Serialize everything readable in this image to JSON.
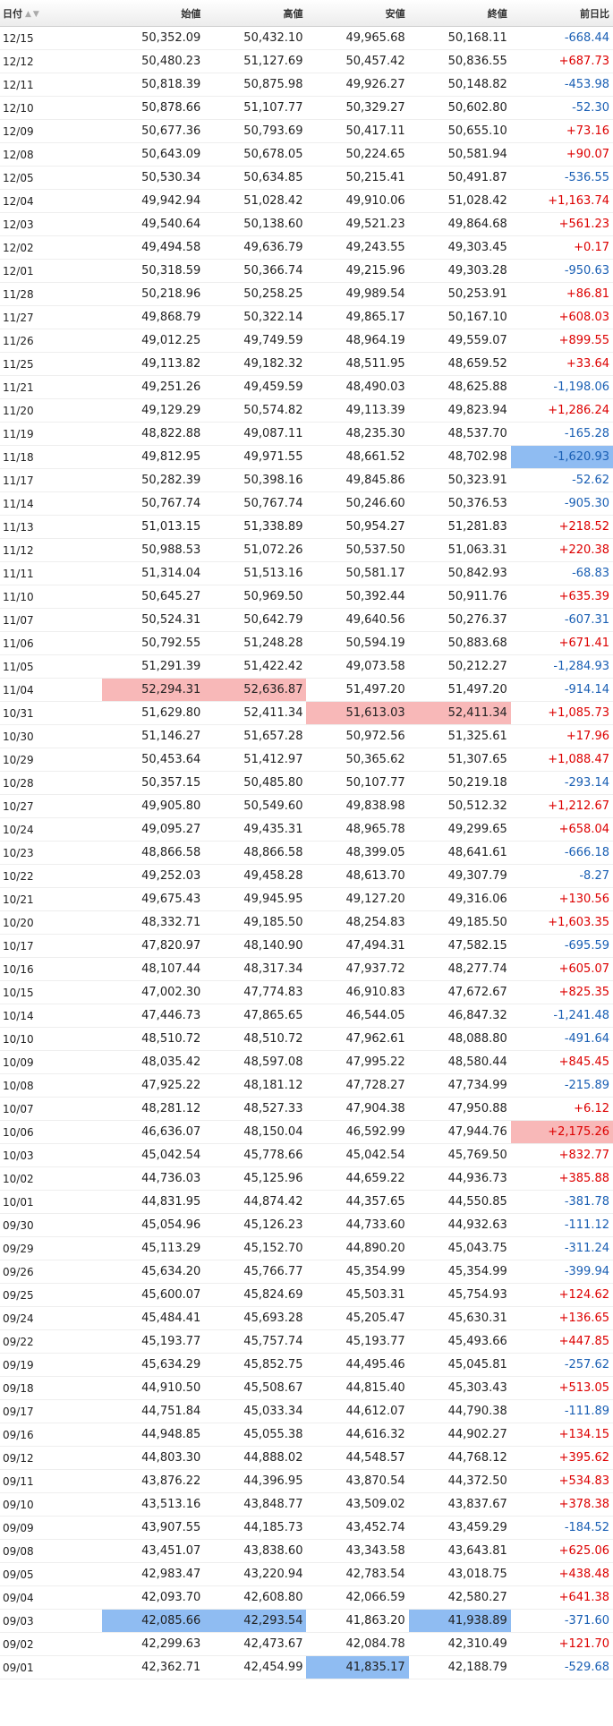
{
  "table": {
    "headers": [
      "日付",
      "始値",
      "高値",
      "安値",
      "終値",
      "前日比"
    ],
    "sort_indicator": "▲▼",
    "rows": [
      {
        "date": "12/15",
        "open": "50,352.09",
        "high": "50,432.10",
        "low": "49,965.68",
        "close": "50,168.11",
        "change": "-668.44"
      },
      {
        "date": "12/12",
        "open": "50,480.23",
        "high": "51,127.69",
        "low": "50,457.42",
        "close": "50,836.55",
        "change": "+687.73"
      },
      {
        "date": "12/11",
        "open": "50,818.39",
        "high": "50,875.98",
        "low": "49,926.27",
        "close": "50,148.82",
        "change": "-453.98"
      },
      {
        "date": "12/10",
        "open": "50,878.66",
        "high": "51,107.77",
        "low": "50,329.27",
        "close": "50,602.80",
        "change": "-52.30"
      },
      {
        "date": "12/09",
        "open": "50,677.36",
        "high": "50,793.69",
        "low": "50,417.11",
        "close": "50,655.10",
        "change": "+73.16"
      },
      {
        "date": "12/08",
        "open": "50,643.09",
        "high": "50,678.05",
        "low": "50,224.65",
        "close": "50,581.94",
        "change": "+90.07"
      },
      {
        "date": "12/05",
        "open": "50,530.34",
        "high": "50,634.85",
        "low": "50,215.41",
        "close": "50,491.87",
        "change": "-536.55"
      },
      {
        "date": "12/04",
        "open": "49,942.94",
        "high": "51,028.42",
        "low": "49,910.06",
        "close": "51,028.42",
        "change": "+1,163.74"
      },
      {
        "date": "12/03",
        "open": "49,540.64",
        "high": "50,138.60",
        "low": "49,521.23",
        "close": "49,864.68",
        "change": "+561.23"
      },
      {
        "date": "12/02",
        "open": "49,494.58",
        "high": "49,636.79",
        "low": "49,243.55",
        "close": "49,303.45",
        "change": "+0.17"
      },
      {
        "date": "12/01",
        "open": "50,318.59",
        "high": "50,366.74",
        "low": "49,215.96",
        "close": "49,303.28",
        "change": "-950.63"
      },
      {
        "date": "11/28",
        "open": "50,218.96",
        "high": "50,258.25",
        "low": "49,989.54",
        "close": "50,253.91",
        "change": "+86.81"
      },
      {
        "date": "11/27",
        "open": "49,868.79",
        "high": "50,322.14",
        "low": "49,865.17",
        "close": "50,167.10",
        "change": "+608.03"
      },
      {
        "date": "11/26",
        "open": "49,012.25",
        "high": "49,749.59",
        "low": "48,964.19",
        "close": "49,559.07",
        "change": "+899.55"
      },
      {
        "date": "11/25",
        "open": "49,113.82",
        "high": "49,182.32",
        "low": "48,511.95",
        "close": "48,659.52",
        "change": "+33.64"
      },
      {
        "date": "11/21",
        "open": "49,251.26",
        "high": "49,459.59",
        "low": "48,490.03",
        "close": "48,625.88",
        "change": "-1,198.06"
      },
      {
        "date": "11/20",
        "open": "49,129.29",
        "high": "50,574.82",
        "low": "49,113.39",
        "close": "49,823.94",
        "change": "+1,286.24"
      },
      {
        "date": "11/19",
        "open": "48,822.88",
        "high": "49,087.11",
        "low": "48,235.30",
        "close": "48,537.70",
        "change": "-165.28"
      },
      {
        "date": "11/18",
        "open": "49,812.95",
        "high": "49,971.55",
        "low": "48,661.52",
        "close": "48,702.98",
        "change": "-1,620.93",
        "hl": {
          "change": "blue"
        }
      },
      {
        "date": "11/17",
        "open": "50,282.39",
        "high": "50,398.16",
        "low": "49,845.86",
        "close": "50,323.91",
        "change": "-52.62"
      },
      {
        "date": "11/14",
        "open": "50,767.74",
        "high": "50,767.74",
        "low": "50,246.60",
        "close": "50,376.53",
        "change": "-905.30"
      },
      {
        "date": "11/13",
        "open": "51,013.15",
        "high": "51,338.89",
        "low": "50,954.27",
        "close": "51,281.83",
        "change": "+218.52"
      },
      {
        "date": "11/12",
        "open": "50,988.53",
        "high": "51,072.26",
        "low": "50,537.50",
        "close": "51,063.31",
        "change": "+220.38"
      },
      {
        "date": "11/11",
        "open": "51,314.04",
        "high": "51,513.16",
        "low": "50,581.17",
        "close": "50,842.93",
        "change": "-68.83"
      },
      {
        "date": "11/10",
        "open": "50,645.27",
        "high": "50,969.50",
        "low": "50,392.44",
        "close": "50,911.76",
        "change": "+635.39"
      },
      {
        "date": "11/07",
        "open": "50,524.31",
        "high": "50,642.79",
        "low": "49,640.56",
        "close": "50,276.37",
        "change": "-607.31"
      },
      {
        "date": "11/06",
        "open": "50,792.55",
        "high": "51,248.28",
        "low": "50,594.19",
        "close": "50,883.68",
        "change": "+671.41"
      },
      {
        "date": "11/05",
        "open": "51,291.39",
        "high": "51,422.42",
        "low": "49,073.58",
        "close": "50,212.27",
        "change": "-1,284.93"
      },
      {
        "date": "11/04",
        "open": "52,294.31",
        "high": "52,636.87",
        "low": "51,497.20",
        "close": "51,497.20",
        "change": "-914.14",
        "hl": {
          "open": "red",
          "high": "red"
        }
      },
      {
        "date": "10/31",
        "open": "51,629.80",
        "high": "52,411.34",
        "low": "51,613.03",
        "close": "52,411.34",
        "change": "+1,085.73",
        "hl": {
          "low": "red",
          "close": "red"
        }
      },
      {
        "date": "10/30",
        "open": "51,146.27",
        "high": "51,657.28",
        "low": "50,972.56",
        "close": "51,325.61",
        "change": "+17.96"
      },
      {
        "date": "10/29",
        "open": "50,453.64",
        "high": "51,412.97",
        "low": "50,365.62",
        "close": "51,307.65",
        "change": "+1,088.47"
      },
      {
        "date": "10/28",
        "open": "50,357.15",
        "high": "50,485.80",
        "low": "50,107.77",
        "close": "50,219.18",
        "change": "-293.14"
      },
      {
        "date": "10/27",
        "open": "49,905.80",
        "high": "50,549.60",
        "low": "49,838.98",
        "close": "50,512.32",
        "change": "+1,212.67"
      },
      {
        "date": "10/24",
        "open": "49,095.27",
        "high": "49,435.31",
        "low": "48,965.78",
        "close": "49,299.65",
        "change": "+658.04"
      },
      {
        "date": "10/23",
        "open": "48,866.58",
        "high": "48,866.58",
        "low": "48,399.05",
        "close": "48,641.61",
        "change": "-666.18"
      },
      {
        "date": "10/22",
        "open": "49,252.03",
        "high": "49,458.28",
        "low": "48,613.70",
        "close": "49,307.79",
        "change": "-8.27"
      },
      {
        "date": "10/21",
        "open": "49,675.43",
        "high": "49,945.95",
        "low": "49,127.20",
        "close": "49,316.06",
        "change": "+130.56"
      },
      {
        "date": "10/20",
        "open": "48,332.71",
        "high": "49,185.50",
        "low": "48,254.83",
        "close": "49,185.50",
        "change": "+1,603.35"
      },
      {
        "date": "10/17",
        "open": "47,820.97",
        "high": "48,140.90",
        "low": "47,494.31",
        "close": "47,582.15",
        "change": "-695.59"
      },
      {
        "date": "10/16",
        "open": "48,107.44",
        "high": "48,317.34",
        "low": "47,937.72",
        "close": "48,277.74",
        "change": "+605.07"
      },
      {
        "date": "10/15",
        "open": "47,002.30",
        "high": "47,774.83",
        "low": "46,910.83",
        "close": "47,672.67",
        "change": "+825.35"
      },
      {
        "date": "10/14",
        "open": "47,446.73",
        "high": "47,865.65",
        "low": "46,544.05",
        "close": "46,847.32",
        "change": "-1,241.48"
      },
      {
        "date": "10/10",
        "open": "48,510.72",
        "high": "48,510.72",
        "low": "47,962.61",
        "close": "48,088.80",
        "change": "-491.64"
      },
      {
        "date": "10/09",
        "open": "48,035.42",
        "high": "48,597.08",
        "low": "47,995.22",
        "close": "48,580.44",
        "change": "+845.45"
      },
      {
        "date": "10/08",
        "open": "47,925.22",
        "high": "48,181.12",
        "low": "47,728.27",
        "close": "47,734.99",
        "change": "-215.89"
      },
      {
        "date": "10/07",
        "open": "48,281.12",
        "high": "48,527.33",
        "low": "47,904.38",
        "close": "47,950.88",
        "change": "+6.12"
      },
      {
        "date": "10/06",
        "open": "46,636.07",
        "high": "48,150.04",
        "low": "46,592.99",
        "close": "47,944.76",
        "change": "+2,175.26",
        "hl": {
          "change": "red"
        }
      },
      {
        "date": "10/03",
        "open": "45,042.54",
        "high": "45,778.66",
        "low": "45,042.54",
        "close": "45,769.50",
        "change": "+832.77"
      },
      {
        "date": "10/02",
        "open": "44,736.03",
        "high": "45,125.96",
        "low": "44,659.22",
        "close": "44,936.73",
        "change": "+385.88"
      },
      {
        "date": "10/01",
        "open": "44,831.95",
        "high": "44,874.42",
        "low": "44,357.65",
        "close": "44,550.85",
        "change": "-381.78"
      },
      {
        "date": "09/30",
        "open": "45,054.96",
        "high": "45,126.23",
        "low": "44,733.60",
        "close": "44,932.63",
        "change": "-111.12"
      },
      {
        "date": "09/29",
        "open": "45,113.29",
        "high": "45,152.70",
        "low": "44,890.20",
        "close": "45,043.75",
        "change": "-311.24"
      },
      {
        "date": "09/26",
        "open": "45,634.20",
        "high": "45,766.77",
        "low": "45,354.99",
        "close": "45,354.99",
        "change": "-399.94"
      },
      {
        "date": "09/25",
        "open": "45,600.07",
        "high": "45,824.69",
        "low": "45,503.31",
        "close": "45,754.93",
        "change": "+124.62"
      },
      {
        "date": "09/24",
        "open": "45,484.41",
        "high": "45,693.28",
        "low": "45,205.47",
        "close": "45,630.31",
        "change": "+136.65"
      },
      {
        "date": "09/22",
        "open": "45,193.77",
        "high": "45,757.74",
        "low": "45,193.77",
        "close": "45,493.66",
        "change": "+447.85"
      },
      {
        "date": "09/19",
        "open": "45,634.29",
        "high": "45,852.75",
        "low": "44,495.46",
        "close": "45,045.81",
        "change": "-257.62"
      },
      {
        "date": "09/18",
        "open": "44,910.50",
        "high": "45,508.67",
        "low": "44,815.40",
        "close": "45,303.43",
        "change": "+513.05"
      },
      {
        "date": "09/17",
        "open": "44,751.84",
        "high": "45,033.34",
        "low": "44,612.07",
        "close": "44,790.38",
        "change": "-111.89"
      },
      {
        "date": "09/16",
        "open": "44,948.85",
        "high": "45,055.38",
        "low": "44,616.32",
        "close": "44,902.27",
        "change": "+134.15"
      },
      {
        "date": "09/12",
        "open": "44,803.30",
        "high": "44,888.02",
        "low": "44,548.57",
        "close": "44,768.12",
        "change": "+395.62"
      },
      {
        "date": "09/11",
        "open": "43,876.22",
        "high": "44,396.95",
        "low": "43,870.54",
        "close": "44,372.50",
        "change": "+534.83"
      },
      {
        "date": "09/10",
        "open": "43,513.16",
        "high": "43,848.77",
        "low": "43,509.02",
        "close": "43,837.67",
        "change": "+378.38"
      },
      {
        "date": "09/09",
        "open": "43,907.55",
        "high": "44,185.73",
        "low": "43,452.74",
        "close": "43,459.29",
        "change": "-184.52"
      },
      {
        "date": "09/08",
        "open": "43,451.07",
        "high": "43,838.60",
        "low": "43,343.58",
        "close": "43,643.81",
        "change": "+625.06"
      },
      {
        "date": "09/05",
        "open": "42,983.47",
        "high": "43,220.94",
        "low": "42,783.54",
        "close": "43,018.75",
        "change": "+438.48"
      },
      {
        "date": "09/04",
        "open": "42,093.70",
        "high": "42,608.80",
        "low": "42,066.59",
        "close": "42,580.27",
        "change": "+641.38"
      },
      {
        "date": "09/03",
        "open": "42,085.66",
        "high": "42,293.54",
        "low": "41,863.20",
        "close": "41,938.89",
        "change": "-371.60",
        "hl": {
          "open": "blue",
          "high": "blue",
          "close": "blue"
        }
      },
      {
        "date": "09/02",
        "open": "42,299.63",
        "high": "42,473.67",
        "low": "42,084.78",
        "close": "42,310.49",
        "change": "+121.70"
      },
      {
        "date": "09/01",
        "open": "42,362.71",
        "high": "42,454.99",
        "low": "41,835.17",
        "close": "42,188.79",
        "change": "-529.68",
        "hl": {
          "low": "blue"
        }
      }
    ]
  },
  "colors": {
    "positive": "#dd0000",
    "negative": "#1a5fb4",
    "highlight_red": "#f8b8b8",
    "highlight_blue": "#8fbcf2"
  }
}
